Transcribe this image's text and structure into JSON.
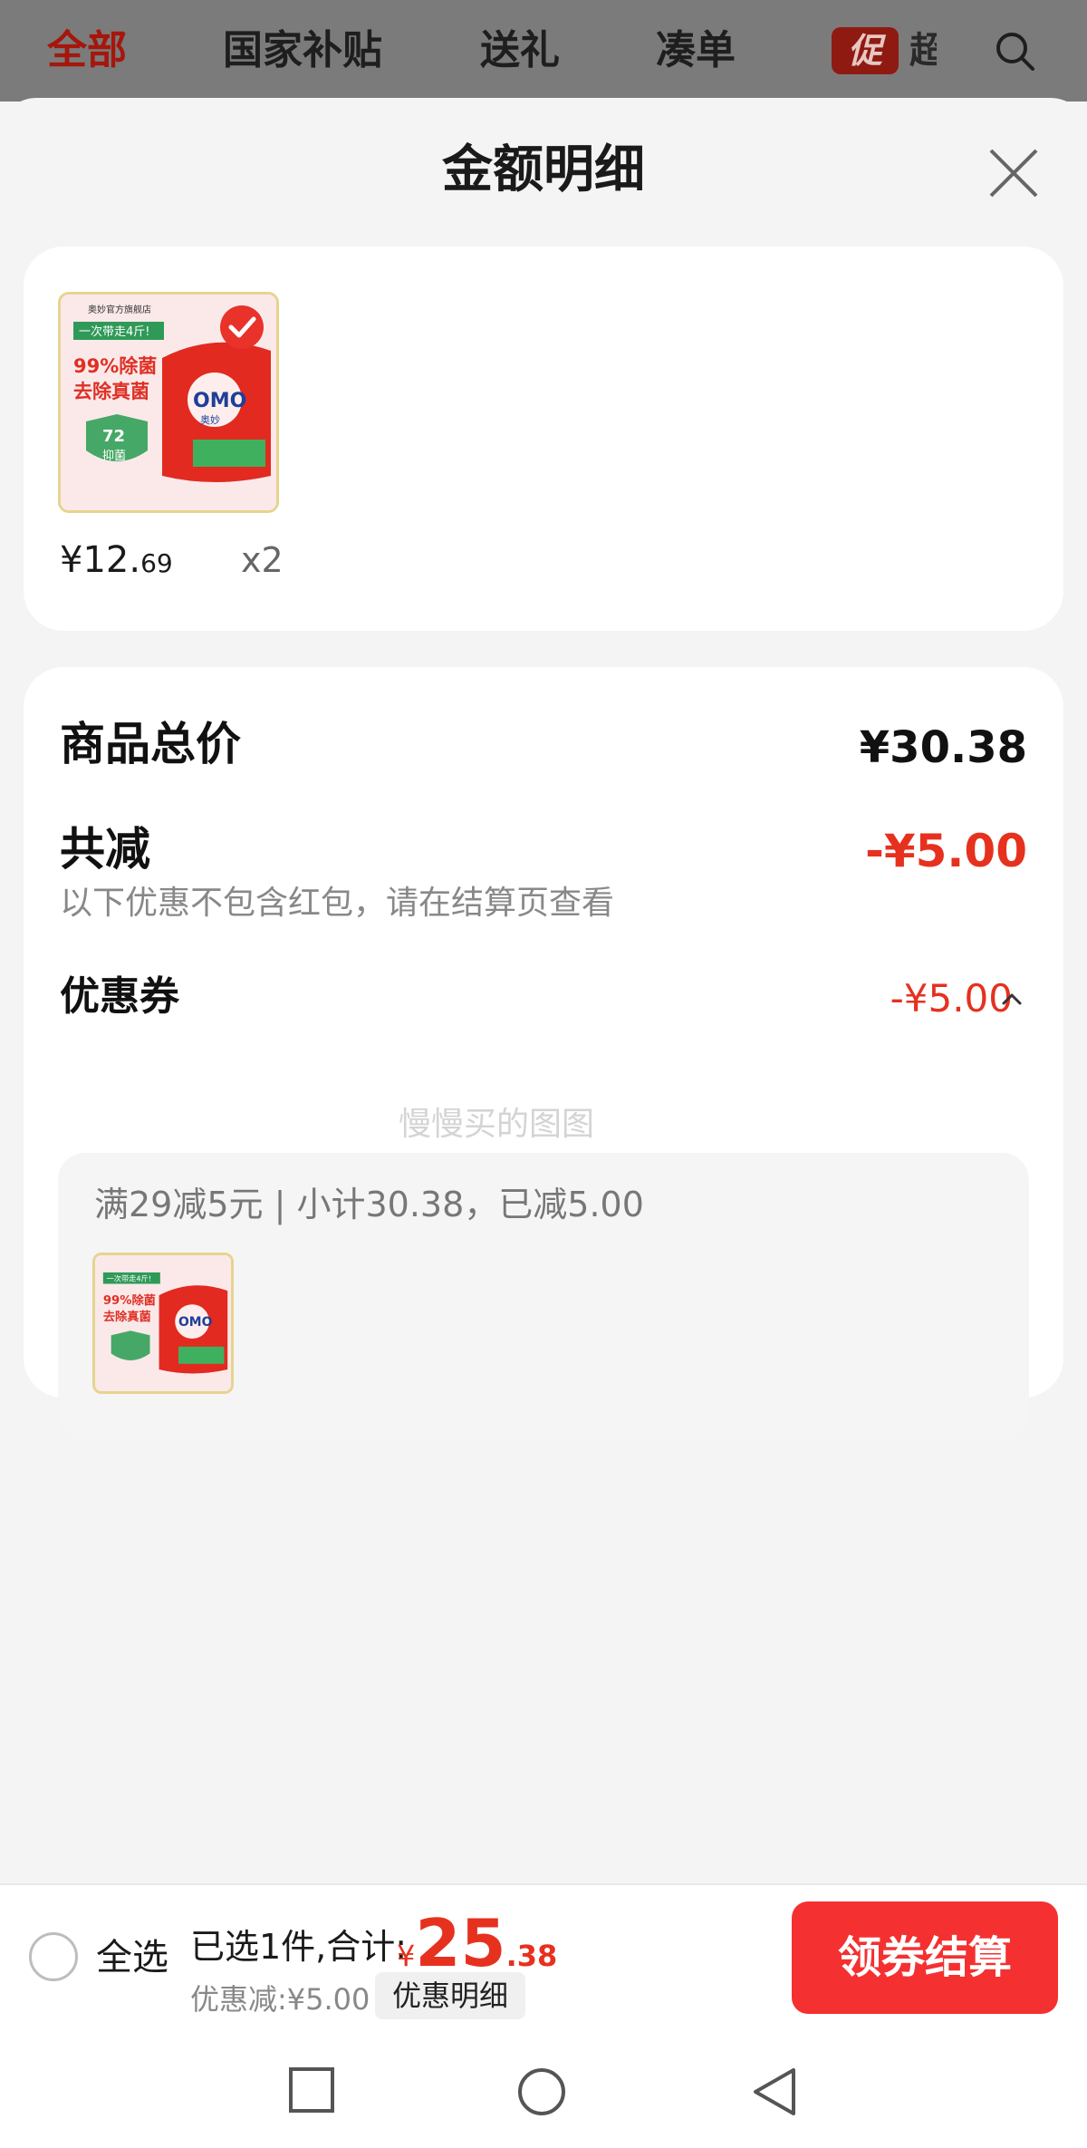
{
  "top_tabs": [
    "全部",
    "国家补贴",
    "送礼",
    "凑单"
  ],
  "promo_badge": "促",
  "promo_next_char": "超",
  "sheet": {
    "title": "金额明细"
  },
  "product": {
    "price_int": "¥12.",
    "price_dec": "69",
    "quantity": "x2",
    "image_text": {
      "store": "奥妙官方旗舰店",
      "ribbon": "一次带走4斤!",
      "line1": "99%除菌",
      "line2": "去除真菌",
      "badge_num": "72",
      "badge_text": "抑菌",
      "brand": "OMO",
      "brand_cn": "奥妙"
    }
  },
  "summary": {
    "total_label": "商品总价",
    "total_value": "¥30.38",
    "reduce_label": "共减",
    "reduce_value": "-¥5.00",
    "hint": "以下优惠不包含红包，请在结算页查看",
    "coupon_label": "优惠券",
    "coupon_value": "-¥5.00",
    "watermark": "慢慢买的图图",
    "coupon_desc": "满29减5元 | 小计30.38，已减5.00"
  },
  "bottom": {
    "select_all": "全选",
    "selected_text": "已选1件,合计:",
    "currency": "¥",
    "amount_int": "25",
    "amount_dec": ".38",
    "discount_text": "优惠减:¥5.00",
    "detail_button": "优惠明细",
    "checkout_button": "领券结算"
  },
  "colors": {
    "accent_red": "#e6311f",
    "checkout_bg": "#f53030"
  }
}
